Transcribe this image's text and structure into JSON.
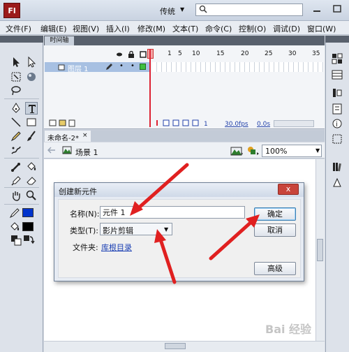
{
  "titlebar": {
    "logo": "Fl",
    "workspace": "传统",
    "search_placeholder": ""
  },
  "menu": {
    "items": [
      "文件(F)",
      "编辑(E)",
      "视图(V)",
      "插入(I)",
      "修改(M)",
      "文本(T)",
      "命令(C)",
      "控制(O)",
      "调试(D)",
      "窗口(W)"
    ]
  },
  "timeline": {
    "tab_label": "时间轴",
    "frame_numbers": [
      "1",
      "5",
      "10",
      "15",
      "20",
      "25",
      "30",
      "35",
      "40",
      "45"
    ],
    "layer_name": "图层 1",
    "current_frame": "1",
    "fps": "30.0fps",
    "time": "0.0s"
  },
  "document": {
    "tab_label": "未命名-2*",
    "close_glyph": "×",
    "scene": "场景 1",
    "zoom": "100%"
  },
  "dialog": {
    "title": "创建新元件",
    "close_glyph": "x",
    "name_label": "名称(N):",
    "name_value": "元件 1",
    "type_label": "类型(T):",
    "type_value": "影片剪辑",
    "folder_label": "文件夹:",
    "folder_value": "库根目录",
    "ok_label": "确定",
    "cancel_label": "取消",
    "advanced_label": "高级"
  },
  "watermark": "Bai 经验",
  "colors": {
    "stroke_color": "#0033cc",
    "fill_color": "#000000",
    "arrow_color": "#e02020"
  }
}
